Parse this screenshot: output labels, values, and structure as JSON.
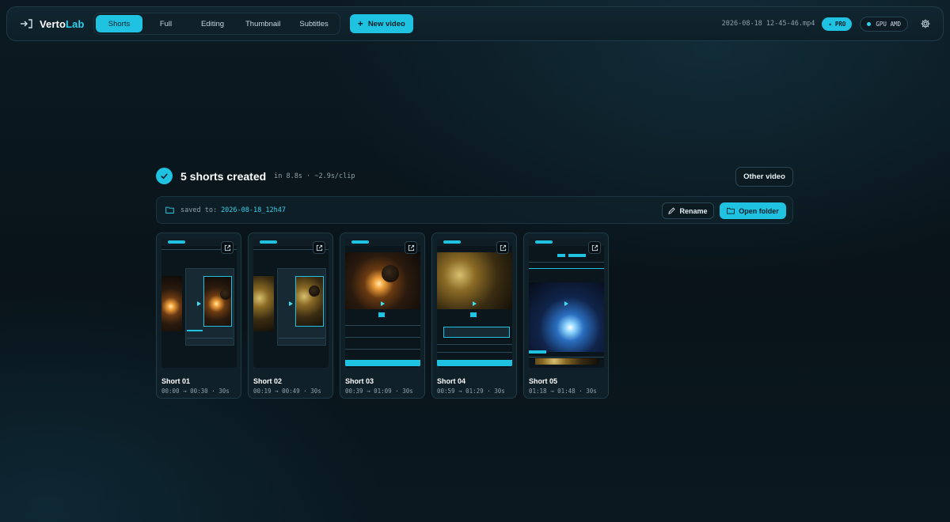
{
  "app": {
    "name_prefix": "Verto",
    "name_suffix": "Lab",
    "logo_icon": "rotate-arrow-icon"
  },
  "nav": {
    "tabs": [
      {
        "label": "Shorts",
        "active": true
      },
      {
        "label": "Full",
        "active": false
      },
      {
        "label": "Editing",
        "active": false
      },
      {
        "label": "Thumbnail",
        "active": false
      },
      {
        "label": "Subtitles",
        "active": false
      }
    ],
    "new_video_label": "New video"
  },
  "header_right": {
    "filename": "2026-08-18 12-45-46.mp4",
    "pro_label": "PRO",
    "gpu_label": "GPU AMD"
  },
  "status": {
    "title": "5 shorts created",
    "meta": "in 8.8s · ~2.9s/clip",
    "other_video_label": "Other video"
  },
  "saved": {
    "label": "saved to:",
    "path": "2026-08-18_12h47",
    "rename_label": "Rename",
    "open_folder_label": "Open folder"
  },
  "shorts": [
    {
      "title": "Short 01",
      "range": "00:00 → 00:30 · 30s"
    },
    {
      "title": "Short 02",
      "range": "00:19 → 00:49 · 30s"
    },
    {
      "title": "Short 03",
      "range": "00:39 → 01:09 · 30s"
    },
    {
      "title": "Short 04",
      "range": "00:59 → 01:29 · 30s"
    },
    {
      "title": "Short 05",
      "range": "01:18 → 01:48 · 30s"
    }
  ],
  "colors": {
    "accent": "#1fc2e0",
    "background": "#091319",
    "panel": "#0f2029"
  }
}
